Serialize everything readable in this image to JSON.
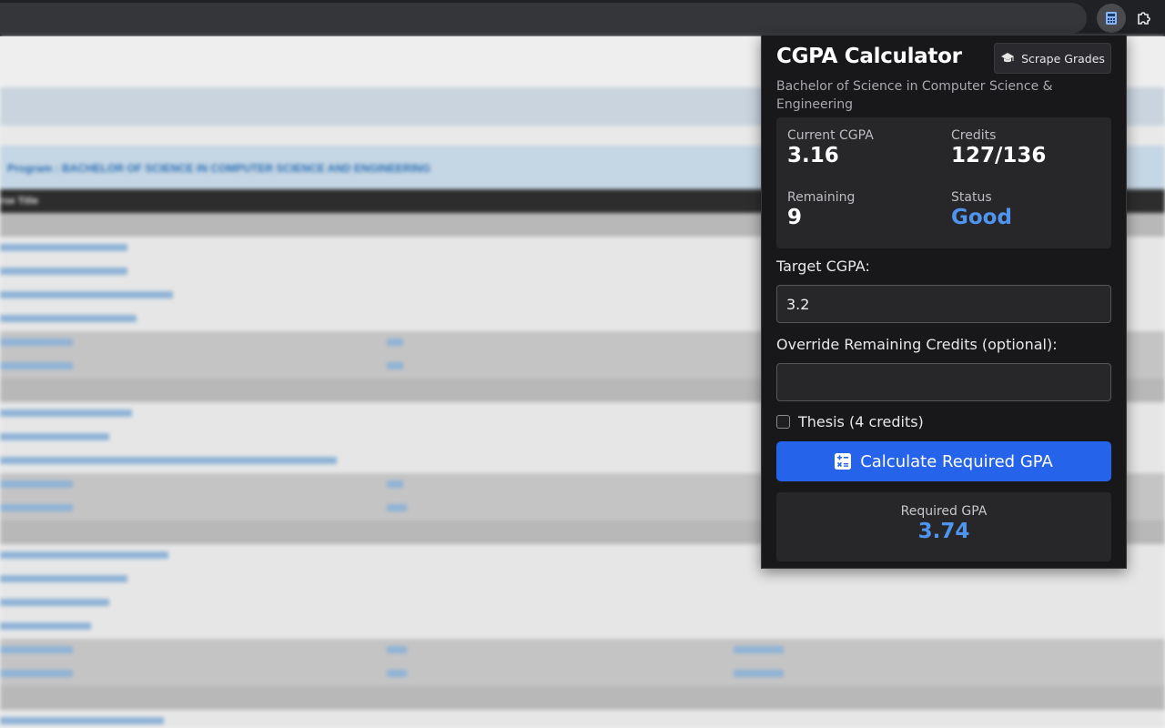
{
  "browser": {
    "extension_icon": "calculator-icon",
    "extensions_icon": "puzzle-icon"
  },
  "background_page": {
    "program_heading": "Program : BACHELOR OF SCIENCE IN COMPUTER SCIENCE AND ENGINEERING",
    "column_header": "rse Title"
  },
  "popup": {
    "title": "CGPA Calculator",
    "scrape_button": {
      "label": "Scrape Grades",
      "icon": "graduation-cap-icon"
    },
    "program": "Bachelor of Science in Computer Science & Engineering",
    "stats": {
      "current_cgpa_label": "Current CGPA",
      "current_cgpa_value": "3.16",
      "credits_label": "Credits",
      "credits_value": "127/136",
      "remaining_label": "Remaining",
      "remaining_value": "9",
      "status_label": "Status",
      "status_value": "Good"
    },
    "target_cgpa": {
      "label": "Target CGPA:",
      "value": "3.2"
    },
    "override_credits": {
      "label": "Override Remaining Credits (optional):",
      "value": ""
    },
    "thesis": {
      "label": "Thesis (4 credits)",
      "checked": false
    },
    "calculate_button": {
      "label": "Calculate Required GPA",
      "icon": "calculator-icon"
    },
    "result": {
      "label": "Required GPA",
      "value": "3.74"
    },
    "colors": {
      "accent": "#2563eb",
      "highlight": "#4f95f0",
      "panel": "#18181b",
      "card": "#27272a"
    }
  }
}
